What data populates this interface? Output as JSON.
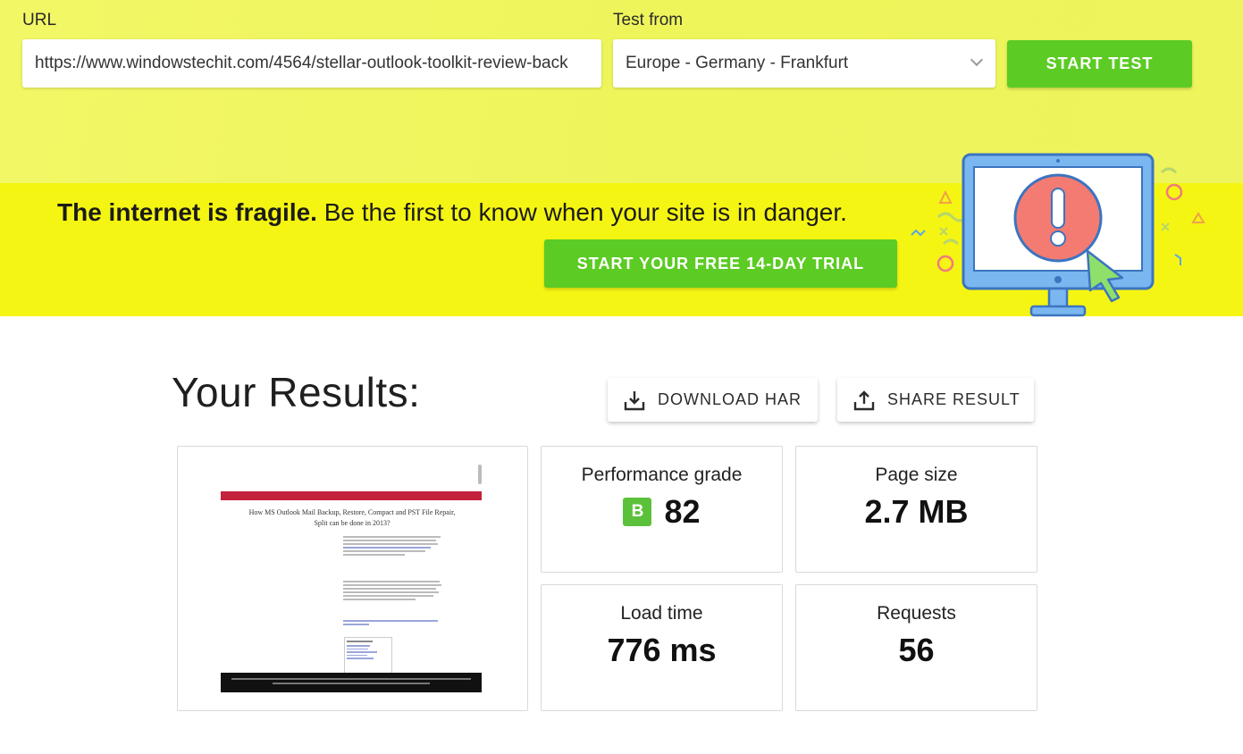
{
  "form": {
    "url_label": "URL",
    "url_value": "https://www.windowstechit.com/4564/stellar-outlook-toolkit-review-back",
    "test_from_label": "Test from",
    "test_from_value": "Europe - Germany - Frankfurt",
    "start_button": "START TEST"
  },
  "banner": {
    "headline_bold": "The internet is fragile.",
    "headline_rest": " Be the first to know when your site is in danger.",
    "trial_button": "START YOUR FREE 14-DAY TRIAL"
  },
  "results": {
    "title": "Your Results:",
    "download_button": "DOWNLOAD HAR",
    "share_button": "SHARE RESULT",
    "screenshot": {
      "page_title": "How MS Outlook Mail Backup, Restore, Compact and PST File Repair, Split can be done in 2013?"
    },
    "metrics": {
      "performance": {
        "label": "Performance grade",
        "grade": "B",
        "value": "82"
      },
      "page_size": {
        "label": "Page size",
        "value": "2.7 MB"
      },
      "load_time": {
        "label": "Load time",
        "value": "776 ms"
      },
      "requests": {
        "label": "Requests",
        "value": "56"
      }
    }
  },
  "colors": {
    "accent_green": "#5ccb24",
    "banner_yellow": "#f5f513",
    "grade_green": "#5cc13a"
  }
}
